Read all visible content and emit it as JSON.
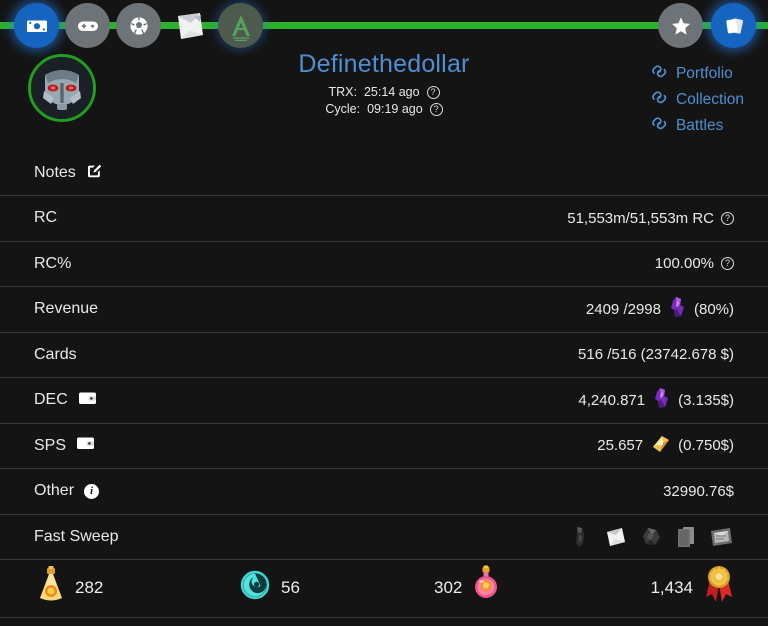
{
  "toolbar": {
    "left_items": [
      {
        "name": "money-icon",
        "label": "Money",
        "state": "active"
      },
      {
        "name": "gamepad-icon",
        "label": "Gamepad",
        "state": "plain"
      },
      {
        "name": "soccer-ball-icon",
        "label": "Battles",
        "state": "plain"
      },
      {
        "name": "white-card-icon",
        "label": "Cards",
        "state": "nobg"
      },
      {
        "name": "altar-a-icon",
        "label": "Altar",
        "state": "ghost"
      }
    ],
    "right_items": [
      {
        "name": "star-icon",
        "label": "Favorites",
        "state": "plain"
      },
      {
        "name": "card-stack-icon",
        "label": "Collection",
        "state": "active"
      }
    ],
    "accent_line_color": "#2bb12b"
  },
  "header": {
    "avatar_name": "robot-avatar",
    "title": "Definethedollar",
    "title_color": "#4f8fd1",
    "trx_label": "TRX:",
    "trx_value": "25:14 ago",
    "cycle_label": "Cycle:",
    "cycle_value": "09:19 ago",
    "help_glyph": "?",
    "links": [
      {
        "label": "Portfolio"
      },
      {
        "label": "Collection"
      },
      {
        "label": "Battles"
      }
    ]
  },
  "rows": [
    {
      "label": "Notes",
      "icon": "edit-icon",
      "value": ""
    },
    {
      "label": "RC",
      "value": "51,553m/51,553m RC",
      "help": true
    },
    {
      "label": "RC%",
      "value": "100.00%",
      "help": true
    },
    {
      "label": "Revenue",
      "value_pre": "2409 /2998",
      "token": "dec-token",
      "value_post": "(80%)"
    },
    {
      "label": "Cards",
      "value": "516 /516 (23742.678 $)"
    },
    {
      "label": "DEC",
      "icon": "wallet-icon",
      "value_pre": "4,240.871",
      "token": "dec-token",
      "value_post": "(3.135$)"
    },
    {
      "label": "SPS",
      "icon": "wallet-icon",
      "value_pre": "25.657",
      "token": "sps-token",
      "value_post": "(0.750$)"
    },
    {
      "label": "Other",
      "icon": "info-icon",
      "value": "32990.76$"
    },
    {
      "label": "Fast Sweep",
      "sweep": true
    }
  ],
  "fast_sweep_icons": [
    {
      "name": "dark-figure-icon"
    },
    {
      "name": "white-paper-icon"
    },
    {
      "name": "dark-lump-icon"
    },
    {
      "name": "card-pair-icon"
    },
    {
      "name": "crate-icon"
    }
  ],
  "bottom_stats": [
    {
      "icon": "gold-potion-icon",
      "value": "282",
      "order": "icon-first"
    },
    {
      "icon": "teal-vortex-icon",
      "value": "56",
      "order": "icon-first"
    },
    {
      "icon": "pink-potion-icon",
      "value": "302",
      "order": "value-first"
    },
    {
      "icon": "gold-medal-icon",
      "value": "1,434",
      "order": "value-first"
    }
  ],
  "colors": {
    "background": "#141414",
    "row_divider": "#3a3a3a",
    "text": "#e9e9e9",
    "accent_blue": "#4f8fd1",
    "accent_green": "#2bb12b"
  }
}
